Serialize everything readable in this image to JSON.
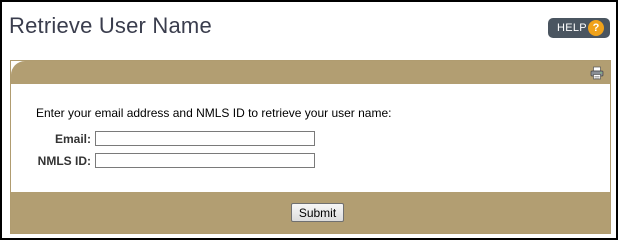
{
  "header": {
    "title": "Retrieve User Name",
    "help_label": "HELP",
    "help_icon": "question-mark",
    "help_icon_glyph": "?"
  },
  "panel": {
    "print_icon": "printer-icon"
  },
  "form": {
    "instructions": "Enter your email address and NMLS ID to retrieve your user name:",
    "email_label": "Email:",
    "email_value": "",
    "nmls_label": "NMLS ID:",
    "nmls_value": "",
    "submit_label": "Submit"
  },
  "colors": {
    "panel_tan": "#b29e72",
    "help_button_bg": "#4a5560",
    "help_icon_orange": "#f0a21a",
    "title_text": "#3a3d4d"
  }
}
